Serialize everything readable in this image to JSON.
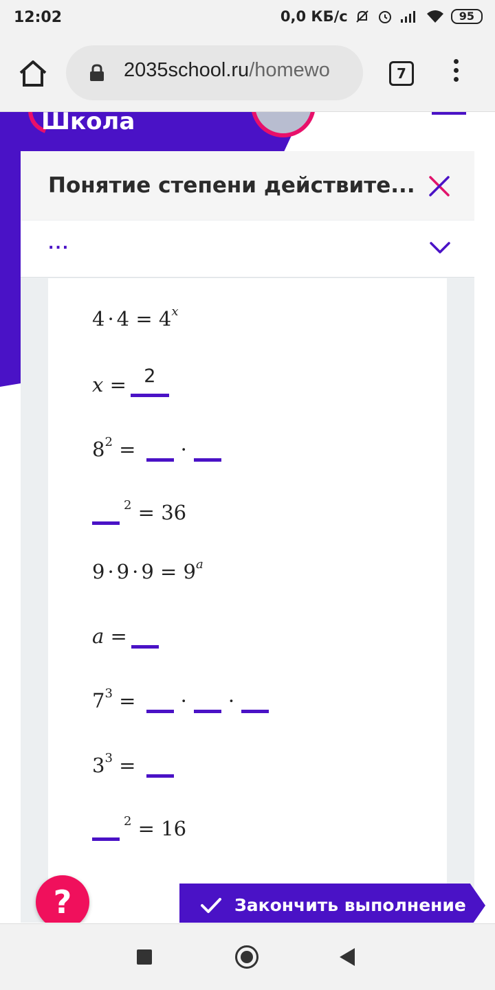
{
  "status_bar": {
    "time": "12:02",
    "network_speed": "0,0 КБ/с",
    "battery": "95"
  },
  "browser": {
    "url_domain": "2035school.ru",
    "url_path": "/homewo",
    "tab_count": "7"
  },
  "page": {
    "logo_text": "Школа",
    "lesson_title": "Понятие степени действите...",
    "dropdown_text": "...",
    "exercises": {
      "e1": {
        "base": "4",
        "lhs_dot": "·",
        "lhs2": "4",
        "eq": "=",
        "rhs": "4",
        "exp": "x"
      },
      "e2": {
        "var": "x",
        "eq": "=",
        "answer": "2"
      },
      "e3": {
        "base": "8",
        "exp": "2",
        "eq": "=",
        "dot": "·"
      },
      "e4": {
        "exp": "2",
        "eq": "=",
        "rhs": "36"
      },
      "e5": {
        "a": "9",
        "b": "9",
        "c": "9",
        "dot": "·",
        "eq": "=",
        "rhs": "9",
        "exp": "a"
      },
      "e6": {
        "var": "a",
        "eq": "="
      },
      "e7": {
        "base": "7",
        "exp": "3",
        "eq": "=",
        "dot": "·"
      },
      "e8": {
        "base": "3",
        "exp": "3",
        "eq": "="
      },
      "e9": {
        "exp": "2",
        "eq": "=",
        "rhs": "16"
      }
    },
    "help_label": "?",
    "finish_label": "Закончить выполнение"
  },
  "colors": {
    "brand_purple": "#4a12c6",
    "brand_pink": "#f0105c",
    "close_pink": "#e0136b"
  }
}
